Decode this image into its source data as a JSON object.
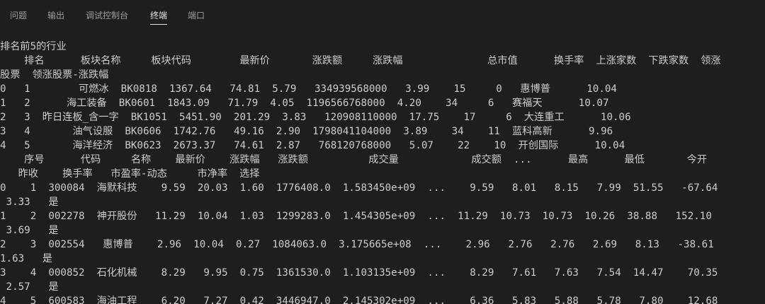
{
  "tabs": [
    {
      "label": "问题",
      "active": false
    },
    {
      "label": "输出",
      "active": false
    },
    {
      "label": "调试控制台",
      "active": false
    },
    {
      "label": "终端",
      "active": true
    },
    {
      "label": "端口",
      "active": false
    }
  ],
  "terminal": {
    "lines": [
      "排名前5的行业",
      "    排名      板块名称     板块代码        最新价       涨跌额     涨跌幅              总市值      换手率  上涨家数  下跌家数  领涨",
      "股票  领涨股票-涨跌幅",
      "0   1        可燃冰  BK0818  1367.64   74.81  5.79   334939568000   3.99    15     0   惠博普      10.04",
      "1   2      海工装备  BK0601  1843.09   71.79  4.05  1196566768000  4.20    34     6   赛福天      10.07",
      "2   3  昨日连板_含一字  BK1051  5451.90  201.29  3.83   120908110000  17.75    17     6  大连重工      10.06",
      "3   4       油气设服  BK0606  1742.76   49.16  2.90  1798041104000  3.89    34    11  蓝科高新      9.96",
      "4   5       海洋经济  BK0623  2673.37   74.61  2.87   768120768000   5.07    22    10  开创国际      10.04",
      "    序号      代码     名称    最新价    涨跌幅   涨跌额          成交量            成交额  ...      最高      最低       今开",
      "   昨收    换手率   市盈率-动态     市净率  选择",
      "0    1  300084  海默科技    9.59  20.03  1.60  1776408.0  1.583450e+09  ...    9.59   8.01   8.15   7.99  51.55   -67.64",
      " 3.33   是",
      "1    2  002278  神开股份   11.29  10.04  1.03  1299283.0  1.454305e+09  ...  11.29  10.73  10.73  10.26  38.88   152.10",
      " 3.69   是",
      "2    3  002554   惠博普    2.96  10.04  0.27  1084063.0  3.175665e+08  ...    2.96   2.76   2.76   2.69   8.13   -38.61",
      "1.63   是",
      "3    4  000852  石化机械    8.29   9.95  0.75  1361530.0  1.103135e+09  ...    8.29   7.61   7.63   7.54  14.47    70.35",
      " 2.57   是",
      "4    5  600583  海油工程    6.20   7.27  0.42  3446947.0  2.145302e+09  ...    6.36   5.83   5.88   5.78   7.80    12.68"
    ]
  }
}
